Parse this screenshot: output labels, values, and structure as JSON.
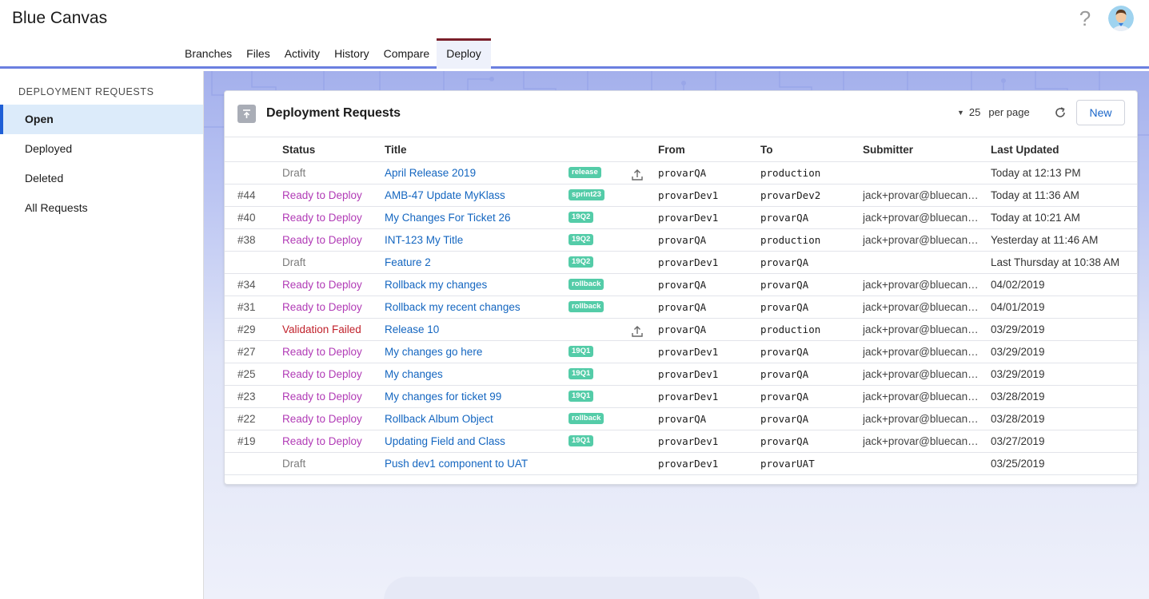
{
  "app": {
    "title": "Blue Canvas"
  },
  "nav": {
    "tabs": [
      {
        "label": "Branches",
        "active": false
      },
      {
        "label": "Files",
        "active": false
      },
      {
        "label": "Activity",
        "active": false
      },
      {
        "label": "History",
        "active": false
      },
      {
        "label": "Compare",
        "active": false
      },
      {
        "label": "Deploy",
        "active": true
      }
    ]
  },
  "header": {
    "help_icon": "question-mark-icon",
    "avatar_icon": "user-avatar-icon"
  },
  "sidebar": {
    "heading": "DEPLOYMENT REQUESTS",
    "items": [
      {
        "label": "Open",
        "active": true
      },
      {
        "label": "Deployed",
        "active": false
      },
      {
        "label": "Deleted",
        "active": false
      },
      {
        "label": "All Requests",
        "active": false
      }
    ]
  },
  "card": {
    "title": "Deployment Requests",
    "per_page_value": "25",
    "per_page_label": "per page",
    "new_label": "New"
  },
  "table": {
    "columns": [
      "Status",
      "Title",
      "From",
      "To",
      "Submitter",
      "Last Updated"
    ],
    "rows": [
      {
        "num": "",
        "status": "Draft",
        "status_type": "draft",
        "title": "April Release 2019",
        "tag": "release",
        "upload": true,
        "from": "provarQA",
        "to": "production",
        "submitter": "",
        "updated": "Today at 12:13 PM"
      },
      {
        "num": "#44",
        "status": "Ready to Deploy",
        "status_type": "ready",
        "title": "AMB-47 Update MyKlass",
        "tag": "sprint23",
        "upload": false,
        "from": "provarDev1",
        "to": "provarDev2",
        "submitter": "jack+provar@bluecanvas.io",
        "updated": "Today at 11:36 AM"
      },
      {
        "num": "#40",
        "status": "Ready to Deploy",
        "status_type": "ready",
        "title": "My Changes For Ticket 26",
        "tag": "19Q2",
        "upload": false,
        "from": "provarDev1",
        "to": "provarQA",
        "submitter": "jack+provar@bluecanvas.io",
        "updated": "Today at 10:21 AM"
      },
      {
        "num": "#38",
        "status": "Ready to Deploy",
        "status_type": "ready",
        "title": "INT-123 My Title",
        "tag": "19Q2",
        "upload": false,
        "from": "provarQA",
        "to": "production",
        "submitter": "jack+provar@bluecanvas.io",
        "updated": "Yesterday at 11:46 AM"
      },
      {
        "num": "",
        "status": "Draft",
        "status_type": "draft",
        "title": "Feature 2",
        "tag": "19Q2",
        "upload": false,
        "from": "provarDev1",
        "to": "provarQA",
        "submitter": "",
        "updated": "Last Thursday at 10:38 AM"
      },
      {
        "num": "#34",
        "status": "Ready to Deploy",
        "status_type": "ready",
        "title": "Rollback my changes",
        "tag": "rollback",
        "upload": false,
        "from": "provarQA",
        "to": "provarQA",
        "submitter": "jack+provar@bluecanvas.io",
        "updated": "04/02/2019"
      },
      {
        "num": "#31",
        "status": "Ready to Deploy",
        "status_type": "ready",
        "title": "Rollback my recent changes",
        "tag": "rollback",
        "upload": false,
        "from": "provarQA",
        "to": "provarQA",
        "submitter": "jack+provar@bluecanvas.io",
        "updated": "04/01/2019"
      },
      {
        "num": "#29",
        "status": "Validation Failed",
        "status_type": "failed",
        "title": "Release 10",
        "tag": "",
        "upload": true,
        "from": "provarQA",
        "to": "production",
        "submitter": "jack+provar@bluecanvas.io",
        "updated": "03/29/2019"
      },
      {
        "num": "#27",
        "status": "Ready to Deploy",
        "status_type": "ready",
        "title": "My changes go here",
        "tag": "19Q1",
        "upload": false,
        "from": "provarDev1",
        "to": "provarQA",
        "submitter": "jack+provar@bluecanvas.io",
        "updated": "03/29/2019"
      },
      {
        "num": "#25",
        "status": "Ready to Deploy",
        "status_type": "ready",
        "title": "My changes",
        "tag": "19Q1",
        "upload": false,
        "from": "provarDev1",
        "to": "provarQA",
        "submitter": "jack+provar@bluecanvas.io",
        "updated": "03/29/2019"
      },
      {
        "num": "#23",
        "status": "Ready to Deploy",
        "status_type": "ready",
        "title": "My changes for ticket 99",
        "tag": "19Q1",
        "upload": false,
        "from": "provarDev1",
        "to": "provarQA",
        "submitter": "jack+provar@bluecanvas.io",
        "updated": "03/28/2019"
      },
      {
        "num": "#22",
        "status": "Ready to Deploy",
        "status_type": "ready",
        "title": "Rollback Album Object",
        "tag": "rollback",
        "upload": false,
        "from": "provarQA",
        "to": "provarQA",
        "submitter": "jack+provar@bluecanvas.io",
        "updated": "03/28/2019"
      },
      {
        "num": "#19",
        "status": "Ready to Deploy",
        "status_type": "ready",
        "title": "Updating Field and Class",
        "tag": "19Q1",
        "upload": false,
        "from": "provarDev1",
        "to": "provarQA",
        "submitter": "jack+provar@bluecanvas.io",
        "updated": "03/27/2019"
      },
      {
        "num": "",
        "status": "Draft",
        "status_type": "draft",
        "title": "Push dev1 component to UAT",
        "tag": "",
        "upload": false,
        "from": "provarDev1",
        "to": "provarUAT",
        "submitter": "",
        "updated": "03/25/2019"
      }
    ]
  },
  "icons": {
    "card": "deploy-arrow-icon",
    "refresh": "refresh-icon",
    "upload": "upload-icon",
    "caret": "caret-down-icon"
  },
  "colors": {
    "accent": "#1f5fd6",
    "active_tab_border": "#7a1f2a",
    "ready": "#b13bb6",
    "failed": "#c0212b",
    "tag": "#54cca8",
    "link": "#1466c0"
  }
}
